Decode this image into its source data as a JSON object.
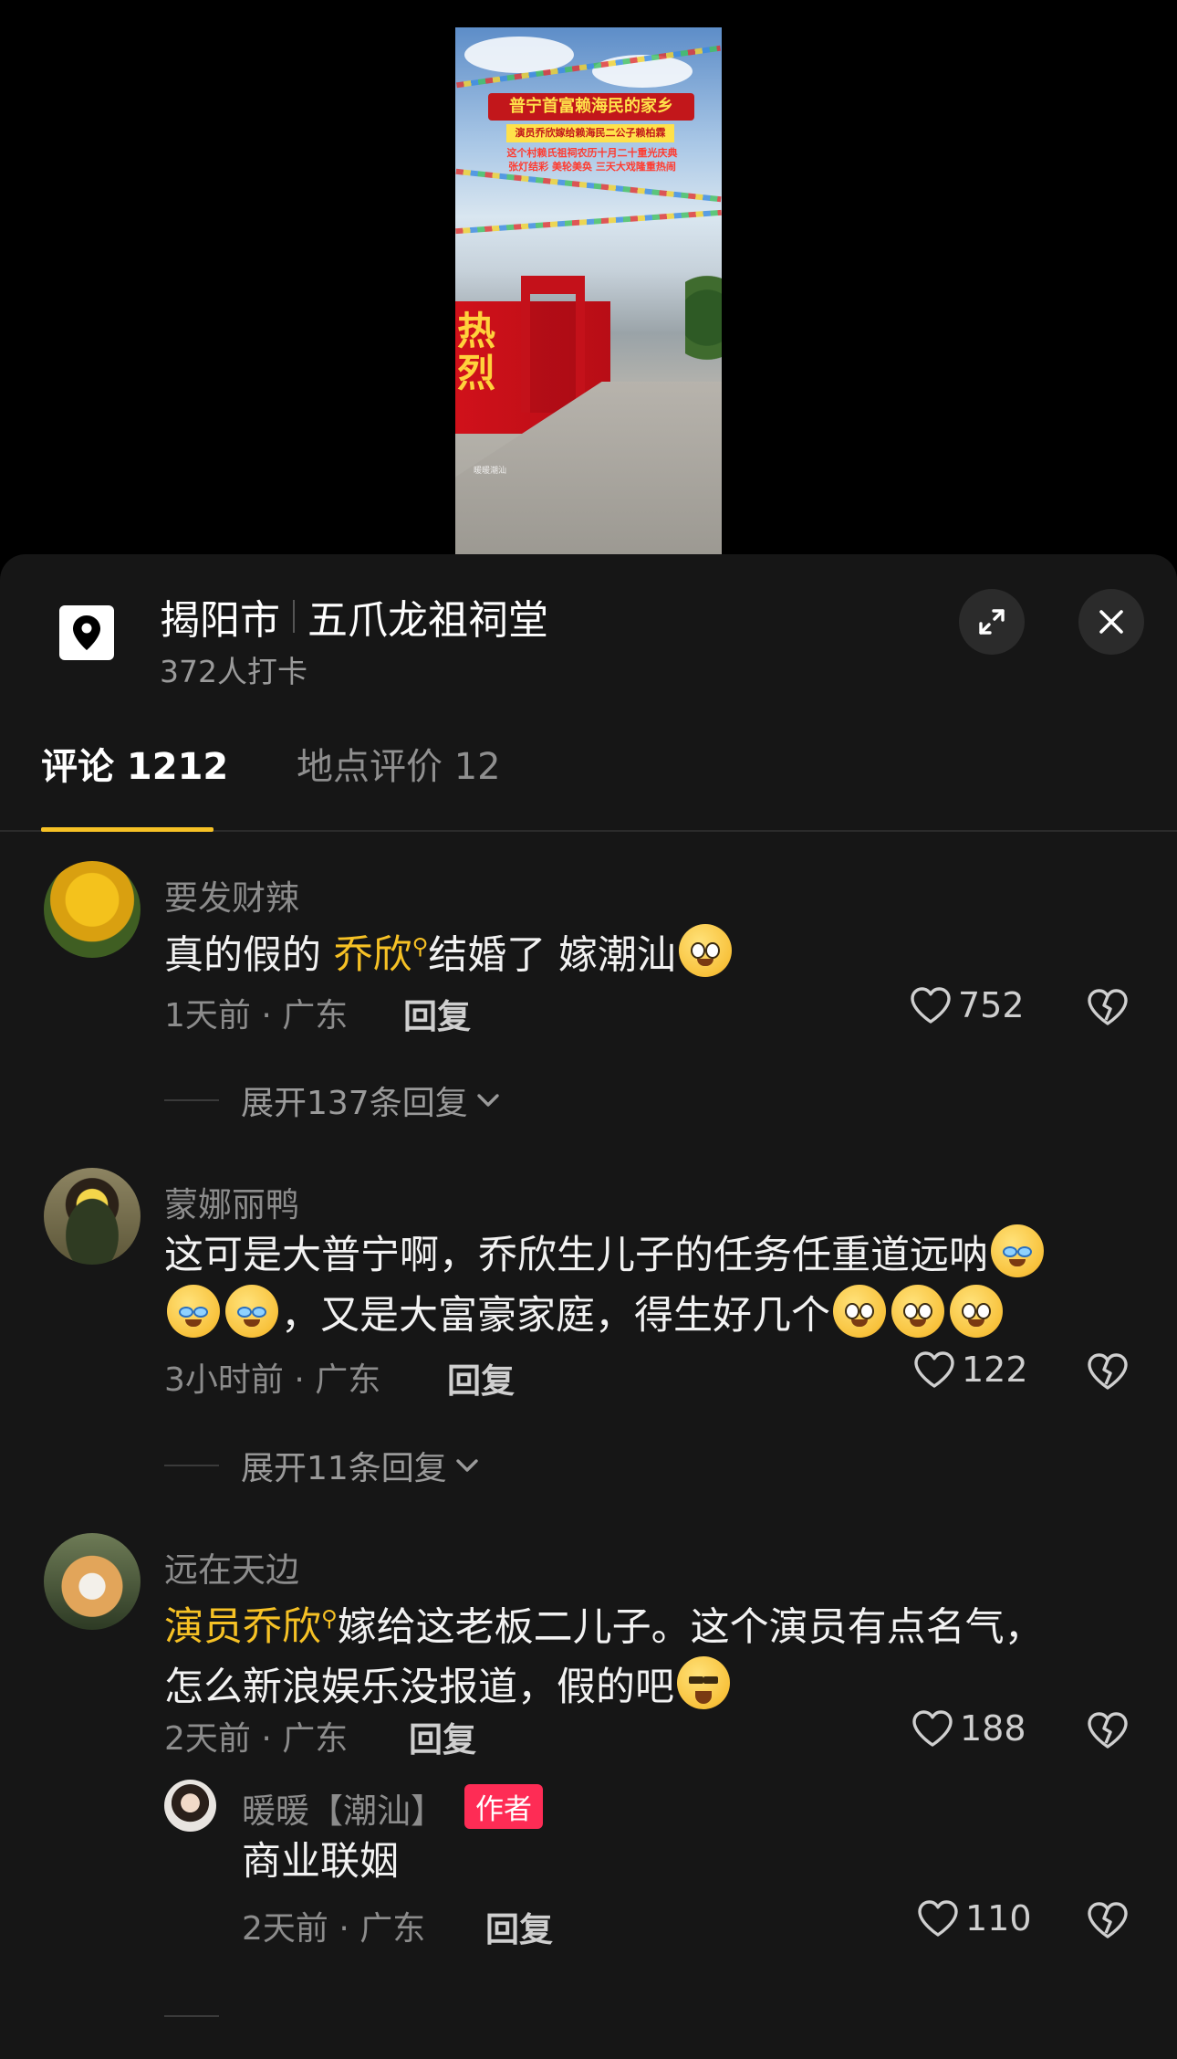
{
  "video": {
    "title": "普宁首富赖海民的家乡",
    "subtitle": "演员乔欣嫁给赖海民二公子赖柏霖",
    "lines": [
      "这个村赖氏祖祠农历十月二十重光庆典",
      "张灯结彩   美轮美奂   三天大戏隆重热闹"
    ],
    "wall_text": "热烈",
    "watermark": "暖暖潮汕"
  },
  "location": {
    "city": "揭阳市",
    "place": "五爪龙祖祠堂",
    "checkins": "372人打卡"
  },
  "tabs": [
    {
      "label": "评论 1212",
      "active": true
    },
    {
      "label": "地点评价 12",
      "active": false
    }
  ],
  "comments": [
    {
      "user": "要发财辣",
      "text_before": "真的假的 ",
      "mention": "乔欣",
      "text_after": "结婚了 嫁潮汕",
      "meta": "1天前 · 广东",
      "reply": "回复",
      "likes": "752",
      "expand": "展开137条回复"
    },
    {
      "user": "蒙娜丽鸭",
      "text_line1": "这可是大普宁啊，乔欣生儿子的任务任重道远呐",
      "text_line2": "，又是大富豪家庭，得生好几个",
      "meta": "3小时前 · 广东",
      "reply": "回复",
      "likes": "122",
      "expand": "展开11条回复"
    },
    {
      "user": "远在天边",
      "mention": "演员乔欣",
      "text_line1": "嫁给这老板二儿子。这个演员有点名气，",
      "text_line2": "怎么新浪娱乐没报道，假的吧",
      "meta": "2天前 · 广东",
      "reply": "回复",
      "likes": "188"
    }
  ],
  "reply": {
    "user": "暖暖【潮汕】",
    "badge": "作者",
    "text": "商业联姻",
    "meta": "2天前 · 广东",
    "reply": "回复",
    "likes": "110"
  },
  "colors": {
    "accent": "#f6c125",
    "sheet_bg": "#161616",
    "author_badge": "#fe2c55"
  },
  "icons": [
    "location-pin-icon",
    "expand-icon",
    "close-icon",
    "heart-icon",
    "dislike-heart-icon",
    "chevron-down-icon",
    "search-small-icon"
  ]
}
